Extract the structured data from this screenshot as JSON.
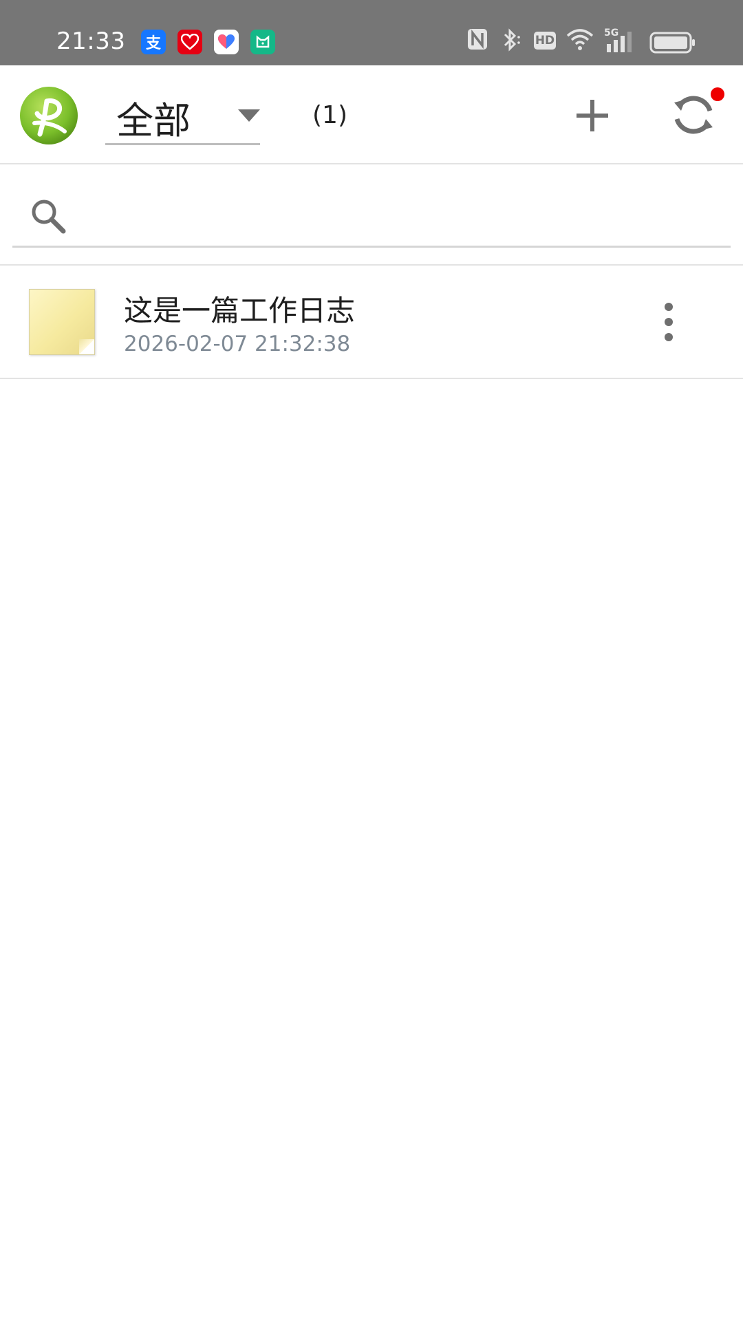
{
  "status_bar": {
    "time": "21:33",
    "notifications": [
      {
        "icon": "alipay-icon",
        "glyph": "支",
        "color": "#1677ff"
      },
      {
        "icon": "taobao-heart-icon",
        "glyph": "♥",
        "color": "#e60012"
      },
      {
        "icon": "health-heart-icon",
        "glyph": "♥",
        "color": "#ffffff"
      },
      {
        "icon": "mi-home-icon",
        "glyph": "▣",
        "color": "#14b888"
      }
    ],
    "indicators": [
      "nfc-icon",
      "bluetooth-icon",
      "hd-icon",
      "wifi-icon",
      "signal-5g-icon",
      "battery-icon"
    ],
    "hd_label": "HD",
    "network_label": "5G"
  },
  "app_bar": {
    "category": "全部",
    "count": "(1)",
    "logo_color": "#7bbf2b",
    "sync_badge_color": "#ee0000"
  },
  "search": {
    "value": "",
    "placeholder": ""
  },
  "notes": [
    {
      "title": "这是一篇工作日志",
      "date": "2026-02-07 21:32:38"
    }
  ]
}
